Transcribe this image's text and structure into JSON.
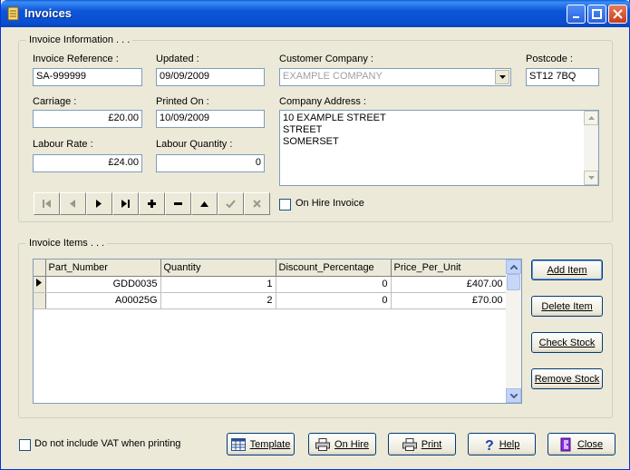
{
  "window": {
    "title": "Invoices"
  },
  "info": {
    "group_title": "Invoice Information . . .",
    "invoice_reference": {
      "label": "Invoice Reference :",
      "value": "SA-999999"
    },
    "updated": {
      "label": "Updated :",
      "value": "09/09/2009"
    },
    "customer_company": {
      "label": "Customer Company :",
      "value": "EXAMPLE COMPANY"
    },
    "postcode": {
      "label": "Postcode :",
      "value": "ST12 7BQ"
    },
    "carriage": {
      "label": "Carriage :",
      "value": "£20.00"
    },
    "printed_on": {
      "label": "Printed On :",
      "value": "10/09/2009"
    },
    "company_address": {
      "label": "Company Address :",
      "lines": [
        "10 EXAMPLE STREET",
        "STREET",
        "SOMERSET"
      ]
    },
    "labour_rate": {
      "label": "Labour Rate :",
      "value": "£24.00"
    },
    "labour_quantity": {
      "label": "Labour Quantity :",
      "value": "0"
    },
    "on_hire": {
      "label": "On Hire Invoice",
      "checked": false
    }
  },
  "items": {
    "group_title": "Invoice Items . . .",
    "columns": [
      "Part_Number",
      "Quantity",
      "Discount_Percentage",
      "Price_Per_Unit"
    ],
    "rows": [
      [
        "GDD0035",
        "1",
        "0",
        "£407.00"
      ],
      [
        "A00025G",
        "2",
        "0",
        "£70.00"
      ]
    ],
    "buttons": {
      "add": "Add Item",
      "delete": "Delete Item",
      "check": "Check Stock",
      "remove": "Remove Stock"
    }
  },
  "footer": {
    "vat_checkbox_label": "Do not include VAT when printing",
    "template": "Template",
    "on_hire": "On Hire",
    "print": "Print",
    "help": "Help",
    "close": "Close"
  }
}
